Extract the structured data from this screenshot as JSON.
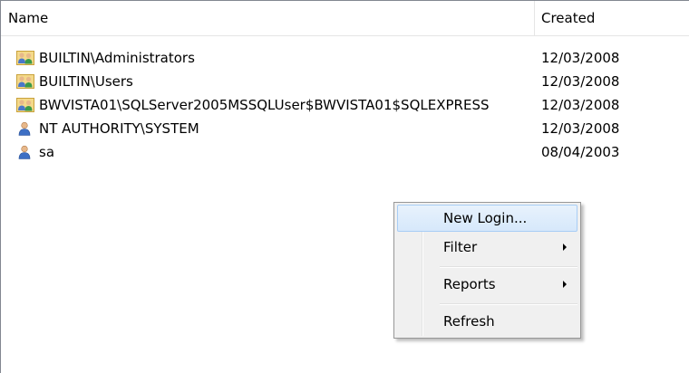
{
  "columns": {
    "name": "Name",
    "created": "Created"
  },
  "logins": [
    {
      "name": "BUILTIN\\Administrators",
      "created": "12/03/2008",
      "icon": "group-icon"
    },
    {
      "name": "BUILTIN\\Users",
      "created": "12/03/2008",
      "icon": "group-icon"
    },
    {
      "name": "BWVISTA01\\SQLServer2005MSSQLUser$BWVISTA01$SQLEXPRESS",
      "created": "12/03/2008",
      "icon": "group-icon"
    },
    {
      "name": "NT AUTHORITY\\SYSTEM",
      "created": "12/03/2008",
      "icon": "user-icon"
    },
    {
      "name": "sa",
      "created": "08/04/2003",
      "icon": "user-icon"
    }
  ],
  "context_menu": {
    "new_login": "New Login...",
    "filter": "Filter",
    "reports": "Reports",
    "refresh": "Refresh"
  },
  "colors": {
    "menu_background": "#f0f0f0",
    "menu_highlight": "#d6e8fb",
    "menu_highlight_border": "#a8cdf5",
    "border": "#828790"
  }
}
